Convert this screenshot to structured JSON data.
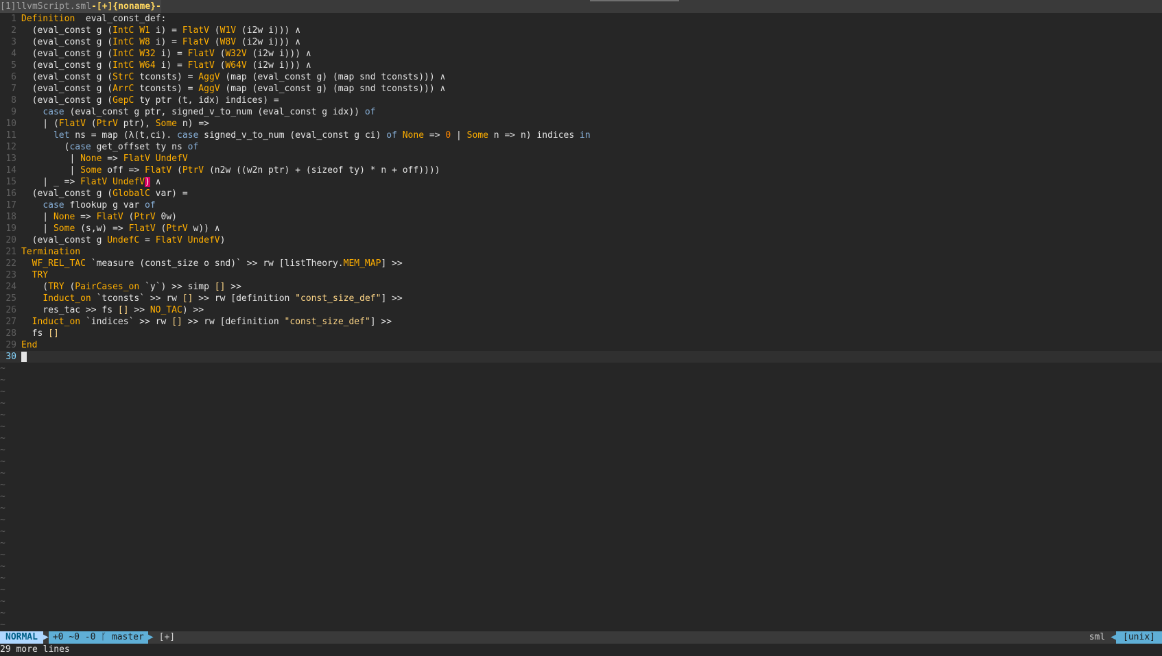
{
  "tabline": {
    "active_tab": "[1]llvmScript.sml",
    "modified_tab": "-[+]{noname}-"
  },
  "lines": [
    {
      "n": "1",
      "t": [
        [
          "kw",
          "Definition"
        ],
        [
          "",
          "  eval_const_def:"
        ]
      ]
    },
    {
      "n": "2",
      "t": [
        [
          "",
          "  (eval_const g "
        ],
        [
          "paren",
          "("
        ],
        [
          "cons",
          "IntC W1"
        ],
        [
          "",
          " i) = "
        ],
        [
          "cons",
          "FlatV"
        ],
        [
          "",
          " ("
        ],
        [
          "cons",
          "W1V"
        ],
        [
          "",
          " (i2w i))) ∧"
        ]
      ]
    },
    {
      "n": "3",
      "t": [
        [
          "",
          "  (eval_const g "
        ],
        [
          "paren",
          "("
        ],
        [
          "cons",
          "IntC W8"
        ],
        [
          "",
          " i) = "
        ],
        [
          "cons",
          "FlatV"
        ],
        [
          "",
          " ("
        ],
        [
          "cons",
          "W8V"
        ],
        [
          "",
          " (i2w i))) ∧"
        ]
      ]
    },
    {
      "n": "4",
      "t": [
        [
          "",
          "  (eval_const g "
        ],
        [
          "paren",
          "("
        ],
        [
          "cons",
          "IntC W32"
        ],
        [
          "",
          " i) = "
        ],
        [
          "cons",
          "FlatV"
        ],
        [
          "",
          " ("
        ],
        [
          "cons",
          "W32V"
        ],
        [
          "",
          " (i2w i))) ∧"
        ]
      ]
    },
    {
      "n": "5",
      "t": [
        [
          "",
          "  (eval_const g "
        ],
        [
          "paren",
          "("
        ],
        [
          "cons",
          "IntC W64"
        ],
        [
          "",
          " i) = "
        ],
        [
          "cons",
          "FlatV"
        ],
        [
          "",
          " ("
        ],
        [
          "cons",
          "W64V"
        ],
        [
          "",
          " (i2w i))) ∧"
        ]
      ]
    },
    {
      "n": "6",
      "t": [
        [
          "",
          "  (eval_const g "
        ],
        [
          "paren",
          "("
        ],
        [
          "cons",
          "StrC"
        ],
        [
          "",
          " tconsts) = "
        ],
        [
          "cons",
          "AggV"
        ],
        [
          "",
          " (map (eval_const g) (map snd tconsts))) ∧"
        ]
      ]
    },
    {
      "n": "7",
      "t": [
        [
          "",
          "  (eval_const g "
        ],
        [
          "paren",
          "("
        ],
        [
          "cons",
          "ArrC"
        ],
        [
          "",
          " tconsts) = "
        ],
        [
          "cons",
          "AggV"
        ],
        [
          "",
          " (map (eval_const g) (map snd tconsts))) ∧"
        ]
      ]
    },
    {
      "n": "8",
      "t": [
        [
          "",
          "  (eval_const g "
        ],
        [
          "paren",
          "("
        ],
        [
          "cons",
          "GepC"
        ],
        [
          "",
          " ty ptr (t, idx) indices) ="
        ]
      ]
    },
    {
      "n": "9",
      "t": [
        [
          "",
          "    "
        ],
        [
          "ctrl",
          "case"
        ],
        [
          "",
          " (eval_const g ptr, signed_v_to_num (eval_const g idx)) "
        ],
        [
          "ctrl",
          "of"
        ]
      ]
    },
    {
      "n": "10",
      "t": [
        [
          "",
          "    | ("
        ],
        [
          "cons",
          "FlatV"
        ],
        [
          "",
          " ("
        ],
        [
          "cons",
          "PtrV"
        ],
        [
          "",
          " ptr), "
        ],
        [
          "cons",
          "Some"
        ],
        [
          "",
          " n) =>"
        ]
      ]
    },
    {
      "n": "11",
      "t": [
        [
          "",
          "      "
        ],
        [
          "ctrl",
          "let"
        ],
        [
          "",
          " ns = map (λ(t,ci). "
        ],
        [
          "ctrl",
          "case"
        ],
        [
          "",
          " signed_v_to_num (eval_const g ci) "
        ],
        [
          "ctrl",
          "of"
        ],
        [
          "",
          " "
        ],
        [
          "cons",
          "None"
        ],
        [
          "",
          " => "
        ],
        [
          "num",
          "0"
        ],
        [
          "",
          " | "
        ],
        [
          "cons",
          "Some"
        ],
        [
          "",
          " n => n) indices "
        ],
        [
          "ctrl",
          "in"
        ]
      ]
    },
    {
      "n": "12",
      "t": [
        [
          "",
          "        ("
        ],
        [
          "ctrl",
          "case"
        ],
        [
          "",
          " get_offset ty ns "
        ],
        [
          "ctrl",
          "of"
        ]
      ]
    },
    {
      "n": "13",
      "t": [
        [
          "",
          "         | "
        ],
        [
          "cons",
          "None"
        ],
        [
          "",
          " => "
        ],
        [
          "cons",
          "FlatV"
        ],
        [
          "",
          " "
        ],
        [
          "cons",
          "UndefV"
        ]
      ]
    },
    {
      "n": "14",
      "t": [
        [
          "",
          "         | "
        ],
        [
          "cons",
          "Some"
        ],
        [
          "",
          " off => "
        ],
        [
          "cons",
          "FlatV"
        ],
        [
          "",
          " ("
        ],
        [
          "cons",
          "PtrV"
        ],
        [
          "",
          " (n2w ((w2n ptr) + (sizeof ty) * n + off))))"
        ]
      ]
    },
    {
      "n": "15",
      "t": [
        [
          "",
          "    | _ => "
        ],
        [
          "cons",
          "FlatV"
        ],
        [
          "",
          " "
        ],
        [
          "cons",
          "UndefV"
        ],
        [
          "hl-paren",
          ")"
        ],
        [
          "",
          " ∧"
        ]
      ]
    },
    {
      "n": "16",
      "t": [
        [
          "",
          "  (eval_const g ("
        ],
        [
          "cons",
          "GlobalC"
        ],
        [
          "",
          " var) ="
        ]
      ]
    },
    {
      "n": "17",
      "t": [
        [
          "",
          "    "
        ],
        [
          "ctrl",
          "case"
        ],
        [
          "",
          " flookup g var "
        ],
        [
          "ctrl",
          "of"
        ]
      ]
    },
    {
      "n": "18",
      "t": [
        [
          "",
          "    | "
        ],
        [
          "cons",
          "None"
        ],
        [
          "",
          " => "
        ],
        [
          "cons",
          "FlatV"
        ],
        [
          "",
          " ("
        ],
        [
          "cons",
          "PtrV"
        ],
        [
          "",
          " 0w)"
        ]
      ]
    },
    {
      "n": "19",
      "t": [
        [
          "",
          "    | "
        ],
        [
          "cons",
          "Some"
        ],
        [
          "",
          " (s,w) => "
        ],
        [
          "cons",
          "FlatV"
        ],
        [
          "",
          " ("
        ],
        [
          "cons",
          "PtrV"
        ],
        [
          "",
          " w)) ∧"
        ]
      ]
    },
    {
      "n": "20",
      "t": [
        [
          "",
          "  (eval_const g "
        ],
        [
          "cons",
          "UndefC"
        ],
        [
          "",
          " = "
        ],
        [
          "cons",
          "FlatV"
        ],
        [
          "",
          " "
        ],
        [
          "cons",
          "UndefV"
        ],
        [
          "",
          ")"
        ]
      ]
    },
    {
      "n": "21",
      "t": [
        [
          "kw",
          "Termination"
        ]
      ]
    },
    {
      "n": "22",
      "t": [
        [
          "",
          "  "
        ],
        [
          "cons",
          "WF_REL_TAC"
        ],
        [
          "",
          " `measure (const_size o snd)` >> rw [listTheory."
        ],
        [
          "cons",
          "MEM_MAP"
        ],
        [
          "",
          "] >>"
        ]
      ]
    },
    {
      "n": "23",
      "t": [
        [
          "",
          "  "
        ],
        [
          "cons",
          "TRY"
        ]
      ]
    },
    {
      "n": "24",
      "t": [
        [
          "",
          "    ("
        ],
        [
          "cons",
          "TRY"
        ],
        [
          "",
          " ("
        ],
        [
          "cons",
          "PairCases_on"
        ],
        [
          "",
          " `y`) >> simp "
        ],
        [
          "str",
          "[]"
        ],
        [
          "",
          " >>"
        ]
      ]
    },
    {
      "n": "25",
      "t": [
        [
          "",
          "    "
        ],
        [
          "cons",
          "Induct_on"
        ],
        [
          "",
          " `tconsts` >> rw "
        ],
        [
          "str",
          "[]"
        ],
        [
          "",
          " >> rw [definition "
        ],
        [
          "str",
          "\"const_size_def\""
        ],
        [
          "",
          "] >>"
        ]
      ]
    },
    {
      "n": "26",
      "t": [
        [
          "",
          "    res_tac >> fs "
        ],
        [
          "str",
          "[]"
        ],
        [
          "",
          " >> "
        ],
        [
          "cons",
          "NO_TAC"
        ],
        [
          "",
          ") >>"
        ]
      ]
    },
    {
      "n": "27",
      "t": [
        [
          "",
          "  "
        ],
        [
          "cons",
          "Induct_on"
        ],
        [
          "",
          " `indices` >> rw "
        ],
        [
          "str",
          "[]"
        ],
        [
          "",
          " >> rw [definition "
        ],
        [
          "str",
          "\"const_size_def\""
        ],
        [
          "",
          "] >>"
        ]
      ]
    },
    {
      "n": "28",
      "t": [
        [
          "",
          "  fs "
        ],
        [
          "str",
          "[]"
        ]
      ]
    },
    {
      "n": "29",
      "t": [
        [
          "kw",
          "End"
        ]
      ]
    },
    {
      "n": "30",
      "t": [],
      "cursor": true
    }
  ],
  "tilde_count": 23,
  "statusline": {
    "mode": "NORMAL",
    "git": "+0 ~0 -0 ᚴ master",
    "modified": "[+]",
    "filetype": "sml",
    "fileformat": "[unix]"
  },
  "cmdline": "29 more lines"
}
